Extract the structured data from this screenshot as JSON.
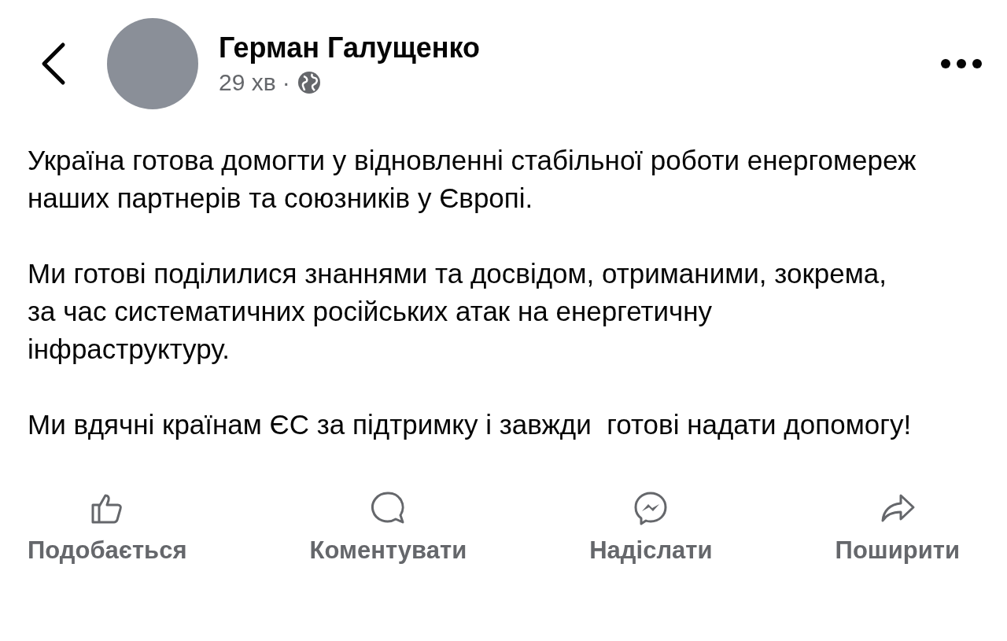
{
  "header": {
    "author": "Герман Галущенко",
    "time": "29 хв",
    "separator": "·"
  },
  "post": {
    "paragraphs": [
      "Україна готова домогти у відновленні стабільної роботи енергомереж наших партнерів та союзників у Європі.",
      "Ми готові поділилися знаннями та досвідом, отриманими, зокрема, за час систематичних російських атак на енергетичну інфраструктуру.",
      "Ми вдячні країнам ЄС за підтримку і завжди  готові надати допомогу!"
    ]
  },
  "actions": [
    {
      "kind": "like",
      "label": "Подобається"
    },
    {
      "kind": "comment",
      "label": "Коментувати"
    },
    {
      "kind": "send",
      "label": "Надіслати"
    },
    {
      "kind": "share",
      "label": "Поширити"
    }
  ]
}
